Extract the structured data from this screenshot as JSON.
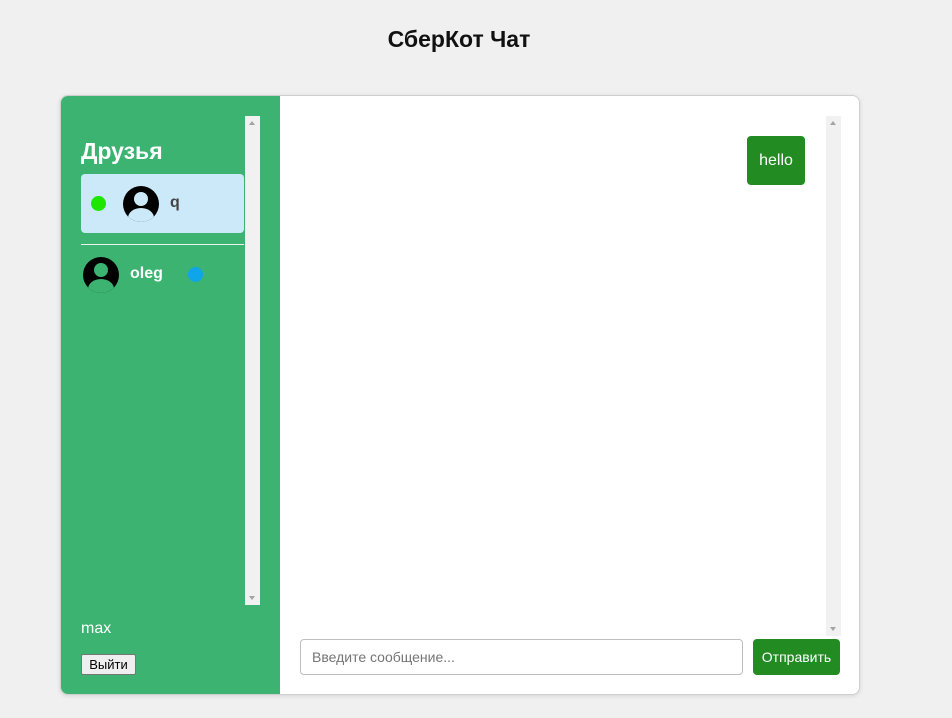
{
  "page": {
    "title": "СберКот Чат"
  },
  "sidebar": {
    "heading": "Друзья",
    "friends": [
      {
        "name": "q",
        "status_color": "#1fe600",
        "active": true
      },
      {
        "name": "oleg",
        "status_color": "#0ea5e9",
        "active": false
      }
    ],
    "current_user": "max",
    "logout_label": "Выйти"
  },
  "chat": {
    "messages": [
      {
        "text": "hello",
        "own": true
      }
    ],
    "input": {
      "value": "",
      "placeholder": "Введите сообщение..."
    },
    "send_label": "Отправить"
  },
  "colors": {
    "sidebar_bg": "#3cb371",
    "active_friend_bg": "#cce9fa",
    "accent": "#228b22",
    "page_bg": "#f0f0f0"
  }
}
